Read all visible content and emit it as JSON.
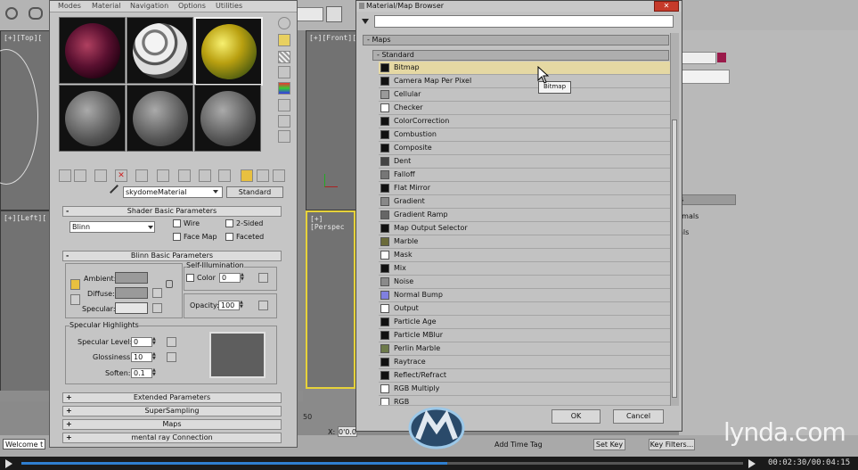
{
  "material_editor": {
    "menu": [
      "Modes",
      "Material",
      "Navigation",
      "Options",
      "Utilities"
    ],
    "material_name": "skydomeMaterial",
    "material_type": "Standard",
    "shader_rollout": "Shader Basic Parameters",
    "shader": "Blinn",
    "options": [
      {
        "label": "Wire",
        "checked": false
      },
      {
        "label": "2-Sided",
        "checked": false
      },
      {
        "label": "Face Map",
        "checked": false
      },
      {
        "label": "Faceted",
        "checked": false
      }
    ],
    "blinn_rollout": "Blinn Basic Parameters",
    "self_illumination": {
      "title": "Self-Illumination",
      "color_label": "Color",
      "value": "0"
    },
    "ambient_label": "Ambient:",
    "diffuse_label": "Diffuse:",
    "specular_label": "Specular:",
    "opacity_label": "Opacity:",
    "opacity_value": "100",
    "highlights": {
      "title": "Specular Highlights",
      "specular_level_label": "Specular Level:",
      "specular_level": "0",
      "glossiness_label": "Glossiness:",
      "glossiness": "10",
      "soften_label": "Soften:",
      "soften": "0.1"
    },
    "collapsed_rollouts": [
      "Extended Parameters",
      "SuperSampling",
      "Maps",
      "mental ray Connection"
    ]
  },
  "browser": {
    "title": "Material/Map Browser",
    "group": "Maps",
    "subgroup": "Standard",
    "items": [
      {
        "name": "Bitmap",
        "color": "#111111"
      },
      {
        "name": "Camera Map Per Pixel",
        "color": "#111111"
      },
      {
        "name": "Cellular",
        "color": "#9a9a9a"
      },
      {
        "name": "Checker",
        "color": "#ffffff"
      },
      {
        "name": "ColorCorrection",
        "color": "#111111"
      },
      {
        "name": "Combustion",
        "color": "#111111"
      },
      {
        "name": "Composite",
        "color": "#111111"
      },
      {
        "name": "Dent",
        "color": "#444444"
      },
      {
        "name": "Falloff",
        "color": "#777777"
      },
      {
        "name": "Flat Mirror",
        "color": "#111111"
      },
      {
        "name": "Gradient",
        "color": "#888888"
      },
      {
        "name": "Gradient Ramp",
        "color": "#666666"
      },
      {
        "name": "Map Output Selector",
        "color": "#111111"
      },
      {
        "name": "Marble",
        "color": "#6b6b3a"
      },
      {
        "name": "Mask",
        "color": "#ffffff"
      },
      {
        "name": "Mix",
        "color": "#111111"
      },
      {
        "name": "Noise",
        "color": "#8a8a8a"
      },
      {
        "name": "Normal Bump",
        "color": "#8080e0"
      },
      {
        "name": "Output",
        "color": "#ffffff"
      },
      {
        "name": "Particle Age",
        "color": "#111111"
      },
      {
        "name": "Particle MBlur",
        "color": "#111111"
      },
      {
        "name": "Perlin Marble",
        "color": "#6d7a4a"
      },
      {
        "name": "Raytrace",
        "color": "#111111"
      },
      {
        "name": "Reflect/Refract",
        "color": "#111111"
      },
      {
        "name": "RGB Multiply",
        "color": "#ffffff"
      },
      {
        "name": "RGB",
        "color": "#ffffff"
      }
    ],
    "selected_index": 0,
    "tooltip": "Bitmap",
    "ok_label": "OK",
    "cancel_label": "Cancel"
  },
  "viewports": {
    "top": "[+][Top][",
    "front": "[+][Front][",
    "left": "[+][Left][",
    "perspective": "[+][Perspec"
  },
  "right_panel": {
    "item1": "rmals",
    "item2": "als",
    "header": "s"
  },
  "status": {
    "prompt": "Welcome t",
    "x_label": "X:",
    "x_value": "0'0.0",
    "add_time_tag": "Add Time Tag",
    "set_key": "Set Key",
    "key_filters": "Key Filters...",
    "timeline_value": "50",
    "time": "00:02:30/00:04:15"
  },
  "watermark": "lynda.com"
}
